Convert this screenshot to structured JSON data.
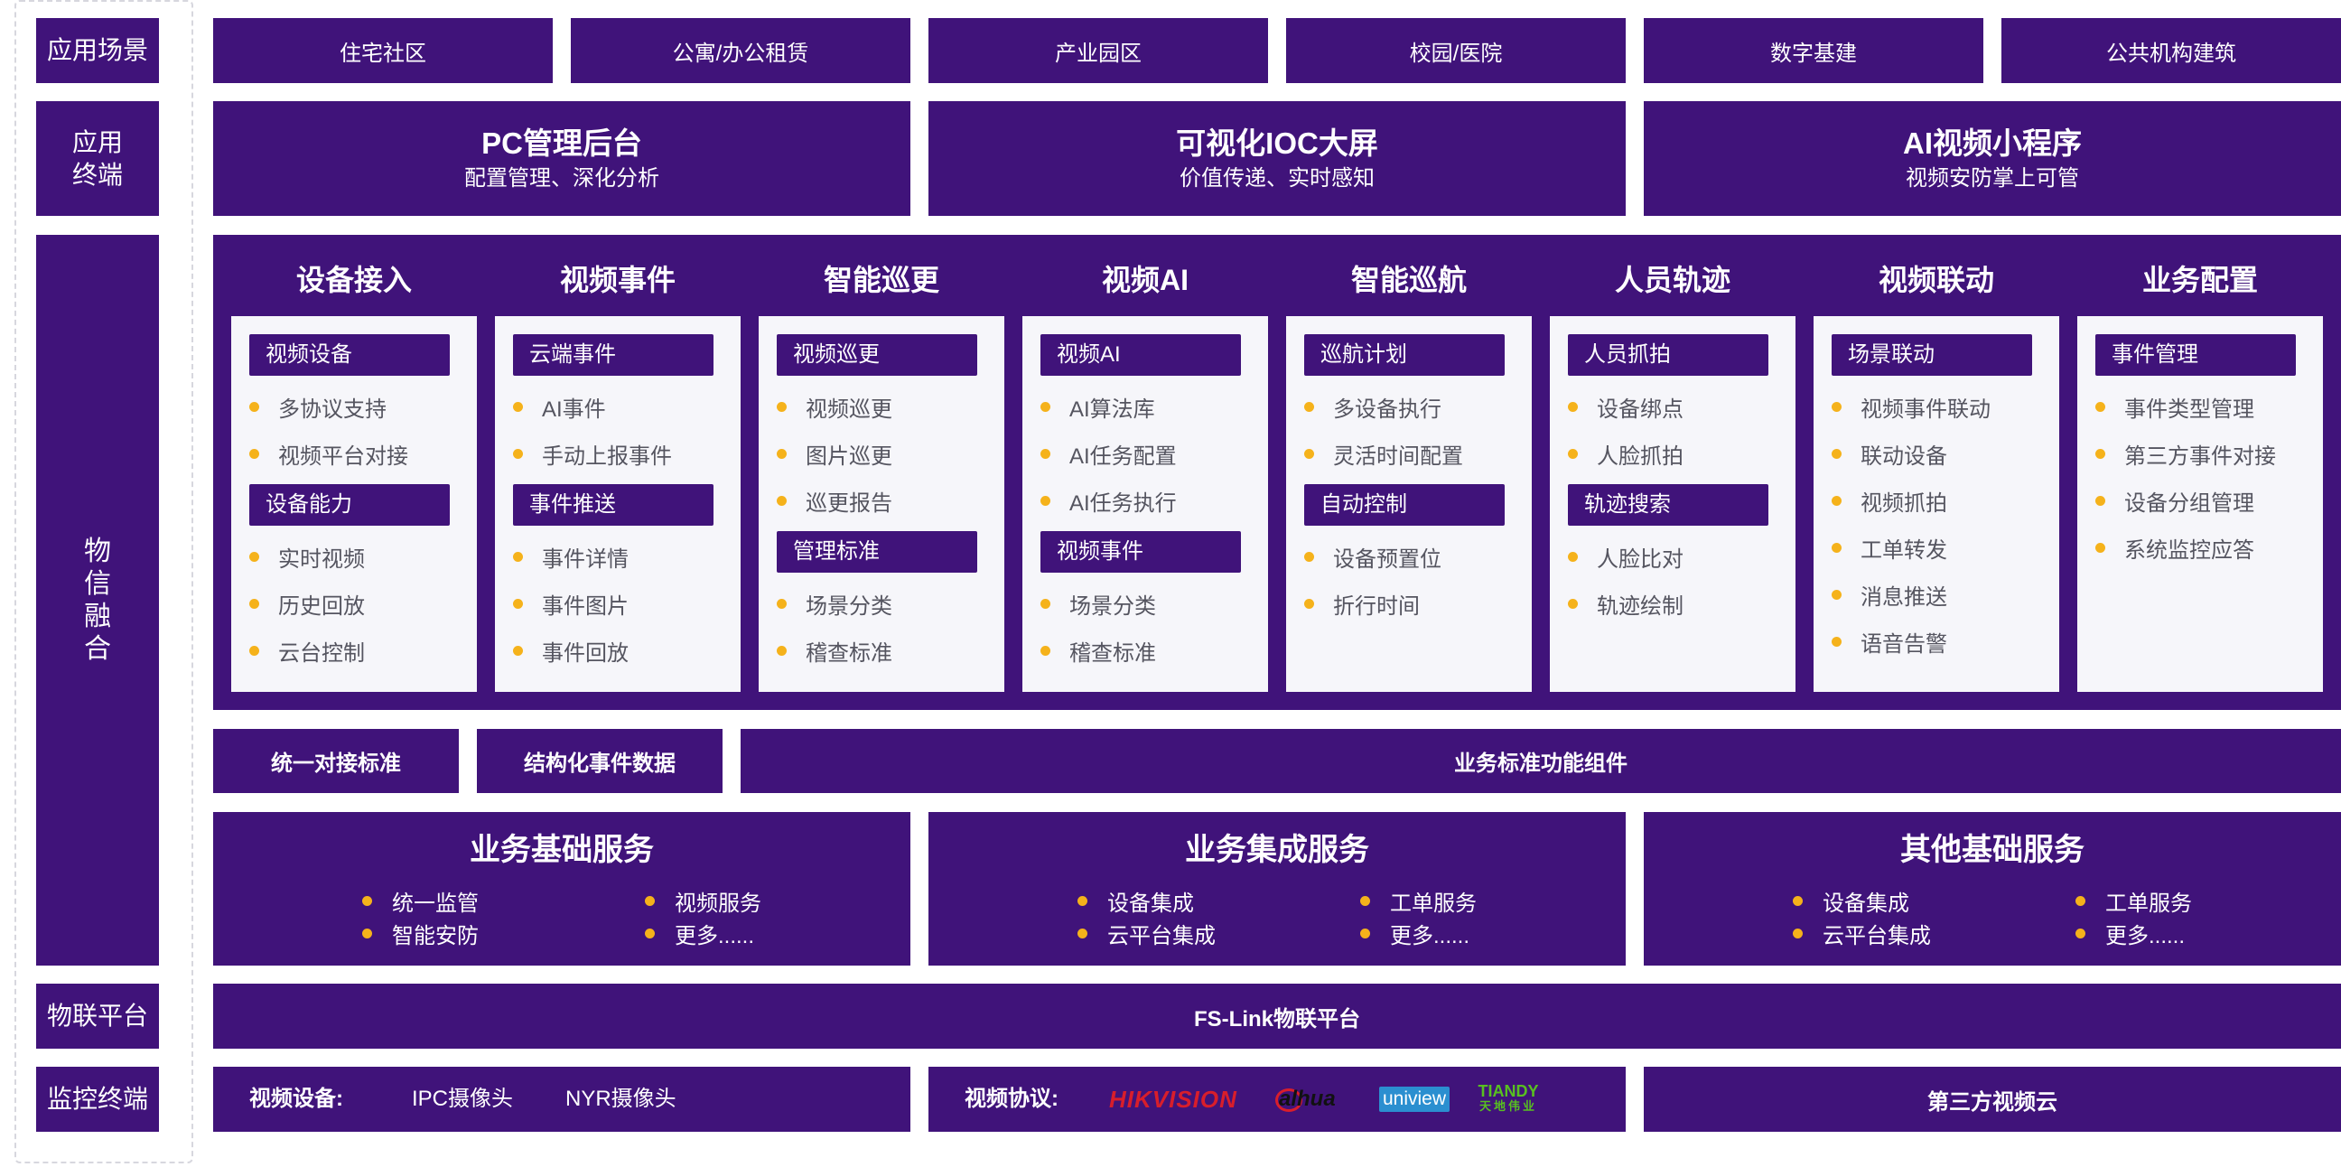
{
  "rows": {
    "scenes": "应用场景",
    "terminals": "应用终端",
    "fusion": "物信融合",
    "iot_platform": "物联平台",
    "monitor_terminals": "监控终端"
  },
  "scenes": [
    "住宅社区",
    "公寓/办公租赁",
    "产业园区",
    "校园/医院",
    "数字基建",
    "公共机构建筑"
  ],
  "terminals": [
    {
      "title": "PC管理后台",
      "subtitle": "配置管理、深化分析"
    },
    {
      "title": "可视化IOC大屏",
      "subtitle": "价值传递、实时感知"
    },
    {
      "title": "AI视频小程序",
      "subtitle": "视频安防掌上可管"
    }
  ],
  "modules": [
    {
      "title": "设备接入",
      "groups": [
        {
          "tag": "视频设备",
          "items": [
            "多协议支持",
            "视频平台对接"
          ]
        },
        {
          "tag": "设备能力",
          "items": [
            "实时视频",
            "历史回放",
            "云台控制"
          ]
        }
      ]
    },
    {
      "title": "视频事件",
      "groups": [
        {
          "tag": "云端事件",
          "items": [
            "AI事件",
            "手动上报事件"
          ]
        },
        {
          "tag": "事件推送",
          "items": [
            "事件详情",
            "事件图片",
            "事件回放"
          ]
        }
      ]
    },
    {
      "title": "智能巡更",
      "groups": [
        {
          "tag": "视频巡更",
          "items": [
            "视频巡更",
            "图片巡更",
            "巡更报告"
          ]
        },
        {
          "tag": "管理标准",
          "items": [
            "场景分类",
            "稽查标准"
          ]
        }
      ]
    },
    {
      "title": "视频AI",
      "groups": [
        {
          "tag": "视频AI",
          "items": [
            "AI算法库",
            "AI任务配置",
            "AI任务执行"
          ]
        },
        {
          "tag": "视频事件",
          "items": [
            "场景分类",
            "稽查标准"
          ]
        }
      ]
    },
    {
      "title": "智能巡航",
      "groups": [
        {
          "tag": "巡航计划",
          "items": [
            "多设备执行",
            "灵活时间配置"
          ]
        },
        {
          "tag": "自动控制",
          "items": [
            "设备预置位",
            "折行时间"
          ]
        }
      ]
    },
    {
      "title": "人员轨迹",
      "groups": [
        {
          "tag": "人员抓拍",
          "items": [
            "设备绑点",
            "人脸抓拍"
          ]
        },
        {
          "tag": "轨迹搜索",
          "items": [
            "人脸比对",
            "轨迹绘制"
          ]
        }
      ]
    },
    {
      "title": "视频联动",
      "groups": [
        {
          "tag": "场景联动",
          "items": [
            "视频事件联动",
            "联动设备",
            "视频抓拍",
            "工单转发",
            "消息推送",
            "语音告警"
          ]
        }
      ]
    },
    {
      "title": "业务配置",
      "groups": [
        {
          "tag": "事件管理",
          "items": [
            "事件类型管理",
            "第三方事件对接",
            "设备分组管理",
            "系统监控应答"
          ]
        }
      ]
    }
  ],
  "standards": [
    "统一对接标准",
    "结构化事件数据",
    "业务标准功能组件"
  ],
  "services": [
    {
      "title": "业务基础服务",
      "items": [
        "统一监管",
        "视频服务",
        "智能安防",
        "更多......"
      ]
    },
    {
      "title": "业务集成服务",
      "items": [
        "设备集成",
        "工单服务",
        "云平台集成",
        "更多......"
      ]
    },
    {
      "title": "其他基础服务",
      "items": [
        "设备集成",
        "工单服务",
        "云平台集成",
        "更多......"
      ]
    }
  ],
  "iot_platform": "FS-Link物联平台",
  "monitor": {
    "devices_label": "视频设备:",
    "devices": [
      "IPC摄像头",
      "NYR摄像头"
    ],
    "protocols_label": "视频协议:",
    "protocol_logos": [
      "HIKVISION",
      "alhua",
      "uniview",
      "TIANDY",
      "天地伟业"
    ],
    "cloud": "第三方视频云"
  },
  "colors": {
    "primary": "#40137a",
    "accent": "#f5b21b",
    "card": "#f6f6fa",
    "item_text": "#555560"
  }
}
